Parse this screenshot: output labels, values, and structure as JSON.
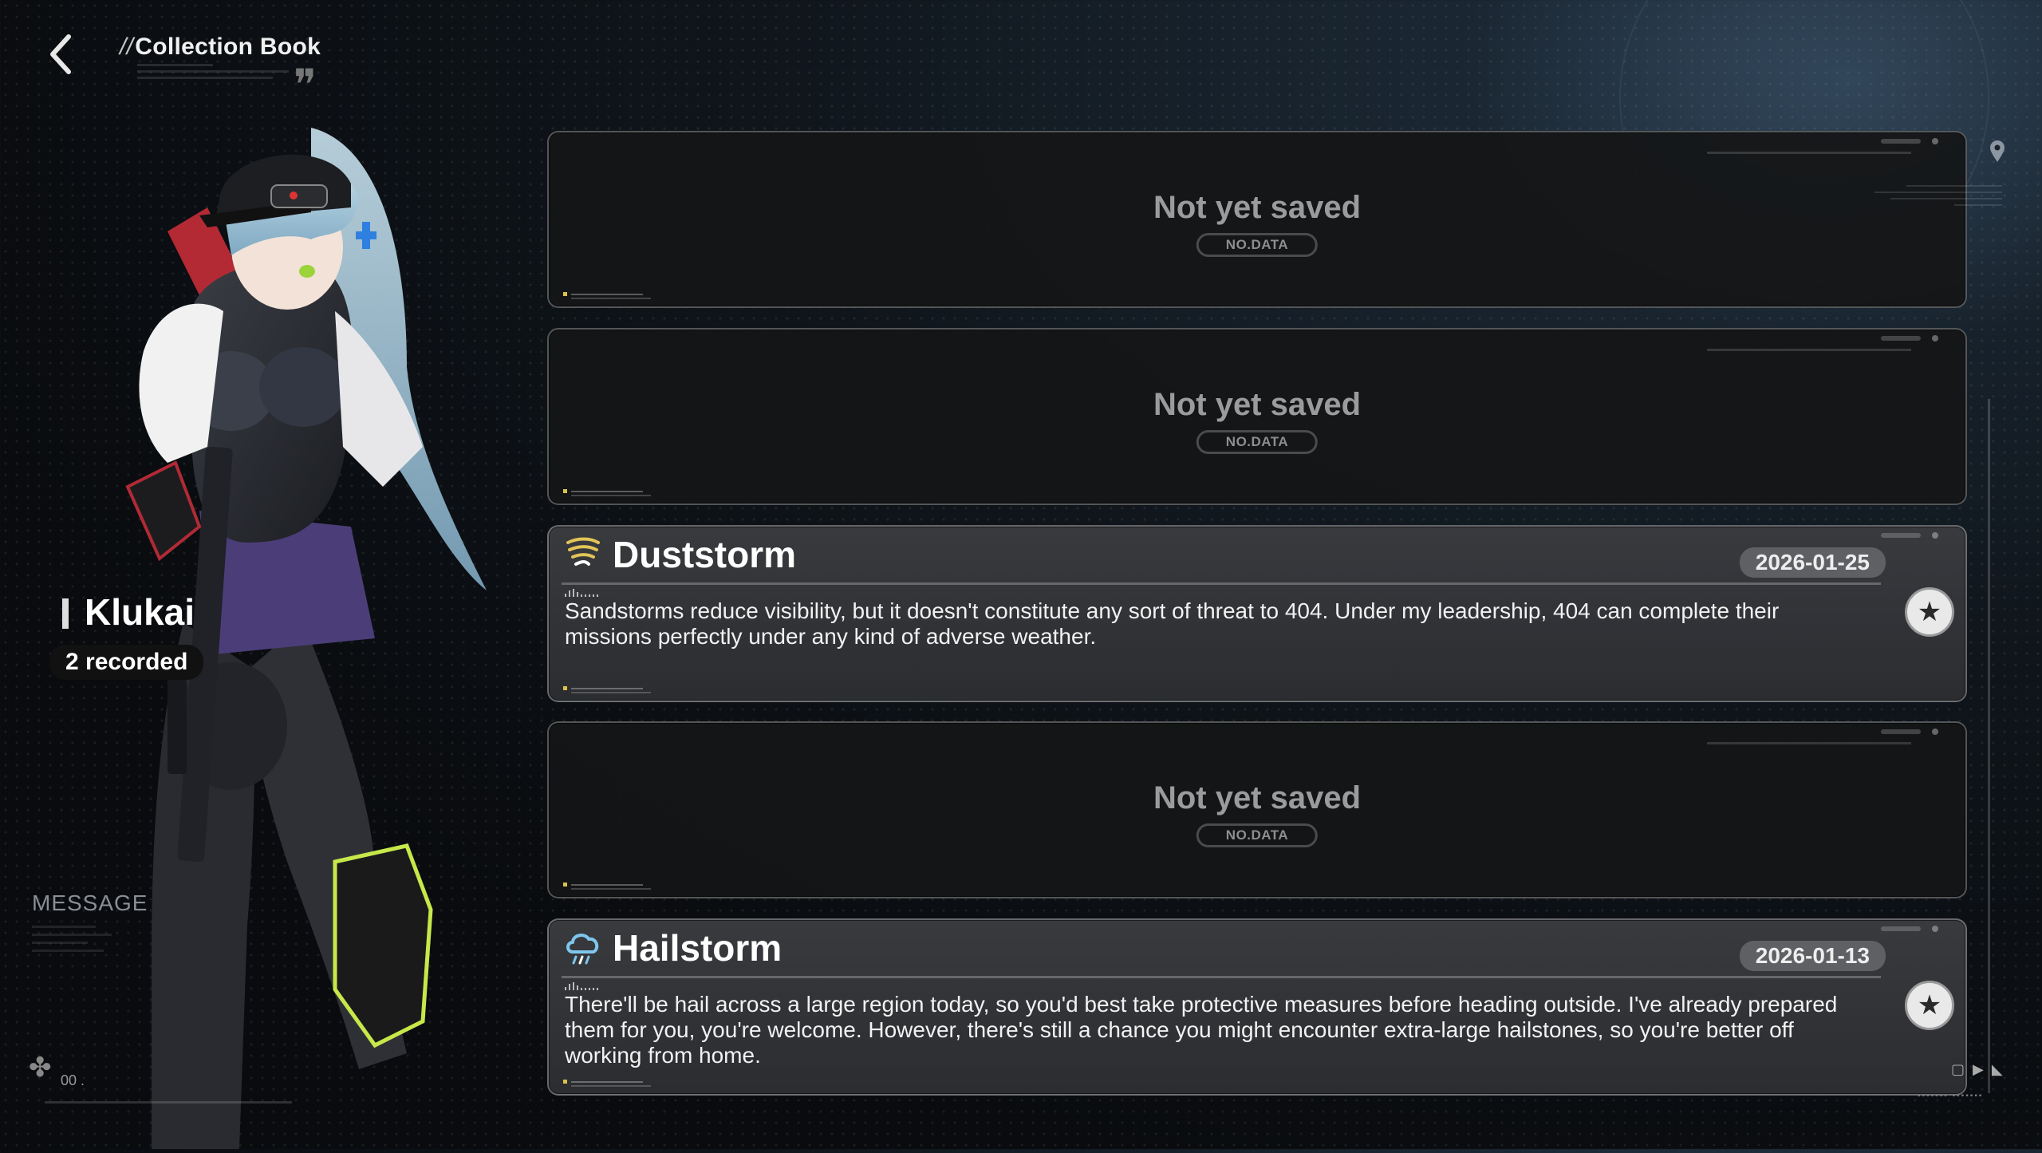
{
  "header": {
    "title_prefix": "//",
    "title": "Collection Book"
  },
  "character": {
    "name": "Klukai",
    "recorded": "2 recorded"
  },
  "sidebar": {
    "message_label": "MESSAGE",
    "bottom_counter": "00 ."
  },
  "entries": [
    {
      "state": "empty",
      "title": "Not yet saved",
      "subtitle": "NO.DATA"
    },
    {
      "state": "empty",
      "title": "Not yet saved",
      "subtitle": "NO.DATA"
    },
    {
      "state": "saved",
      "icon": "duststorm-icon",
      "title": "Duststorm",
      "date": "2026-01-25",
      "text": "Sandstorms reduce visibility, but it doesn't constitute any sort of threat to 404. Under my leadership, 404 can complete their missions perfectly under any kind of adverse weather."
    },
    {
      "state": "empty",
      "title": "Not yet saved",
      "subtitle": "NO.DATA"
    },
    {
      "state": "saved",
      "icon": "hailstorm-icon",
      "title": "Hailstorm",
      "date": "2026-01-13",
      "text": "There'll be hail across a large region today, so you'd best take protective measures before heading outside. I've already prepared them for you, you're welcome. However, there's still a chance you might encounter extra-large hailstones, so you're better off working from home."
    }
  ],
  "colors": {
    "accent_yellow": "#e3c458",
    "hail_blue": "#7fc6ee",
    "card_border": "#ffffff47"
  }
}
